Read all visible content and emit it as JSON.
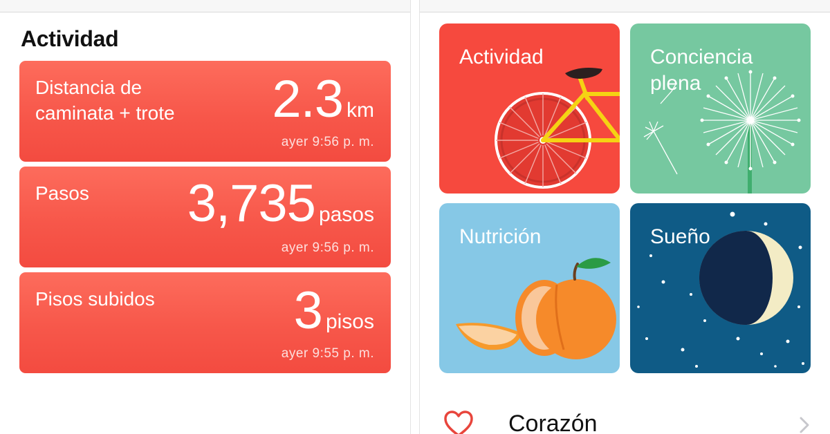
{
  "left": {
    "section_title": "Actividad",
    "metrics": [
      {
        "label": "Distancia de\ncaminata + trote",
        "value": "2.3",
        "unit": "km",
        "time": "ayer 9:56 p. m."
      },
      {
        "label": "Pasos",
        "value": "3,735",
        "unit": "pasos",
        "time": "ayer 9:56 p. m."
      },
      {
        "label": "Pisos subidos",
        "value": "3",
        "unit": "pisos",
        "time": "ayer 9:55 p. m."
      }
    ]
  },
  "right": {
    "categories": [
      {
        "label": "Actividad",
        "icon": "bicycle-icon",
        "color": "#f6493e"
      },
      {
        "label": "Conciencia\nplena",
        "icon": "dandelion-icon",
        "color": "#76c8a0"
      },
      {
        "label": "Nutrición",
        "icon": "peach-icon",
        "color": "#86c8e6"
      },
      {
        "label": "Sueño",
        "icon": "moon-icon",
        "color": "#0f5b86"
      }
    ],
    "list": [
      {
        "label": "Corazón",
        "icon": "heart-icon",
        "color": "#e8453c"
      }
    ]
  }
}
